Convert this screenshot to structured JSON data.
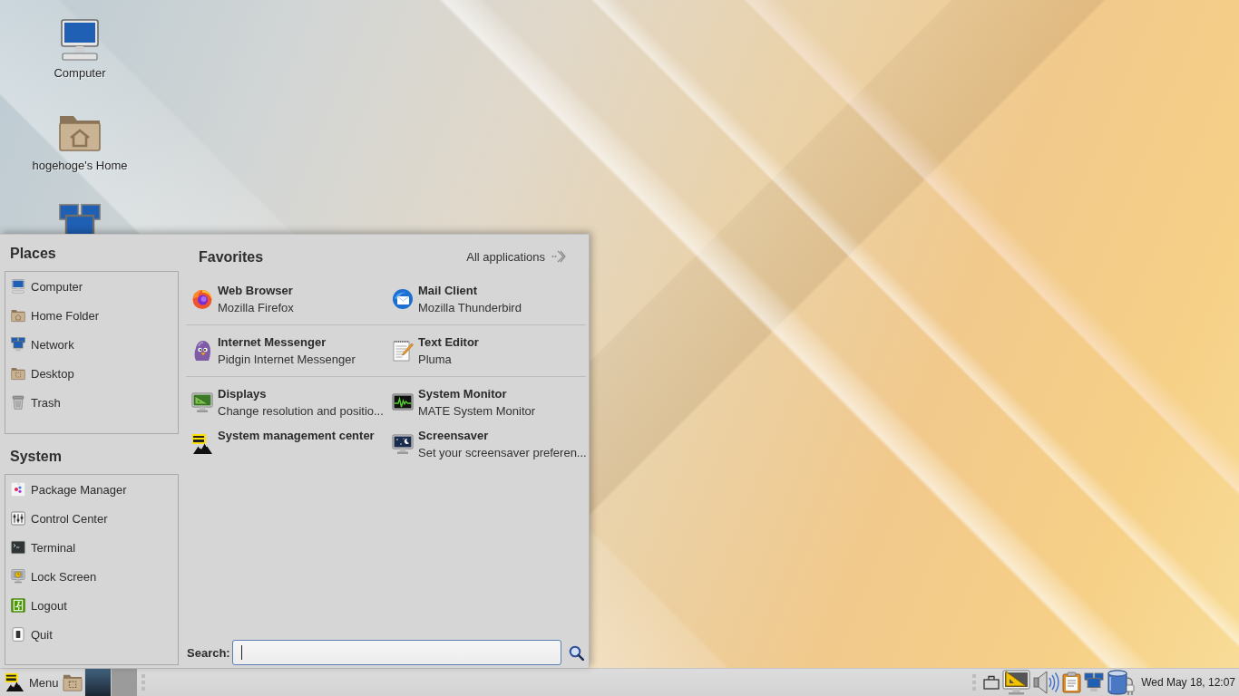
{
  "desktop_icons": [
    {
      "kind": "computer",
      "label": "Computer"
    },
    {
      "kind": "home",
      "label": "hogehoge's Home"
    },
    {
      "kind": "network"
    }
  ],
  "menu": {
    "places": {
      "title": "Places",
      "items": [
        {
          "kind": "computer",
          "label": "Computer"
        },
        {
          "kind": "home",
          "label": "Home Folder"
        },
        {
          "kind": "network",
          "label": "Network"
        },
        {
          "kind": "desktop",
          "label": "Desktop"
        },
        {
          "kind": "trash",
          "label": "Trash"
        }
      ]
    },
    "system": {
      "title": "System",
      "items": [
        {
          "kind": "package",
          "label": "Package Manager"
        },
        {
          "kind": "control",
          "label": "Control Center"
        },
        {
          "kind": "terminal",
          "label": "Terminal"
        },
        {
          "kind": "lock",
          "label": "Lock Screen"
        },
        {
          "kind": "logout",
          "label": "Logout"
        },
        {
          "kind": "quit",
          "label": "Quit"
        }
      ]
    },
    "favorites": {
      "title": "Favorites",
      "all_applications": "All applications",
      "sections": [
        {
          "items": [
            {
              "kind": "firefox",
              "title": "Web Browser",
              "subtitle": "Mozilla Firefox"
            },
            {
              "kind": "thunderbird",
              "title": "Mail Client",
              "subtitle": "Mozilla Thunderbird"
            }
          ]
        },
        {
          "items": [
            {
              "kind": "pidgin",
              "title": "Internet Messenger",
              "subtitle": "Pidgin Internet Messenger"
            },
            {
              "kind": "pluma",
              "title": "Text Editor",
              "subtitle": "Pluma"
            }
          ]
        },
        {
          "items": [
            {
              "kind": "displays",
              "title": "Displays",
              "subtitle": "Change resolution and positio..."
            },
            {
              "kind": "sysmon",
              "title": "System Monitor",
              "subtitle": "MATE System Monitor"
            },
            {
              "kind": "mgmt",
              "title": "System management center"
            },
            {
              "kind": "screensaver",
              "title": "Screensaver",
              "subtitle": "Set your screensaver preferen..."
            }
          ]
        }
      ]
    },
    "search": {
      "label": "Search:",
      "focused": true
    }
  },
  "taskbar": {
    "menu_label": "Menu",
    "workspaces": [
      {
        "selected": true
      },
      {
        "selected": false
      }
    ],
    "clock": "Wed May 18, 12:07"
  }
}
